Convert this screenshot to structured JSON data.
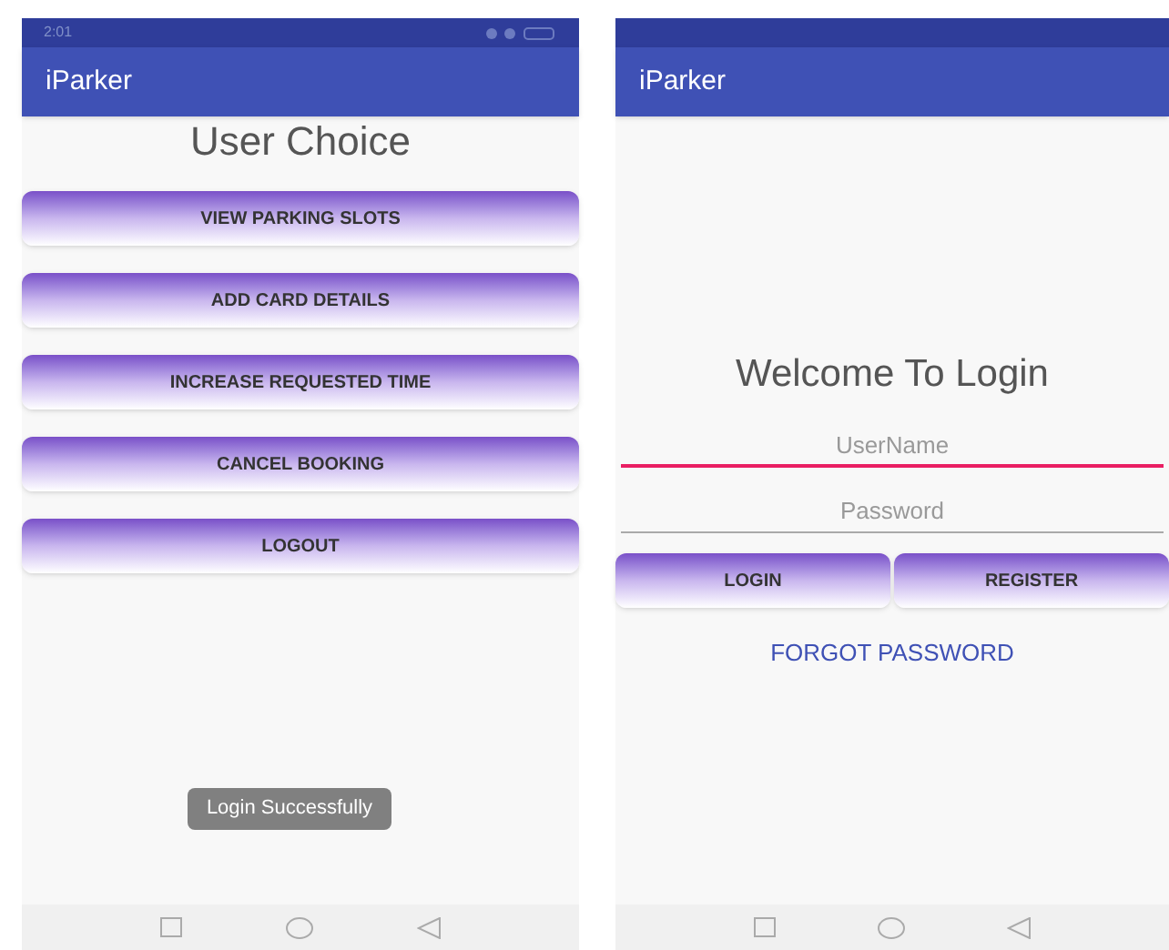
{
  "screens": [
    {
      "status_bar": {
        "time": "2:01"
      },
      "app_bar": {
        "title": "iParker"
      },
      "heading": "User Choice",
      "buttons": [
        "VIEW PARKING SLOTS",
        "ADD CARD DETAILS",
        "INCREASE REQUESTED TIME",
        "CANCEL BOOKING",
        "LOGOUT"
      ],
      "toast": "Login Successfully"
    },
    {
      "app_bar": {
        "title": "iParker"
      },
      "heading": "Welcome To Login",
      "fields": [
        {
          "placeholder": "UserName",
          "focused": true
        },
        {
          "placeholder": "Password",
          "focused": false
        }
      ],
      "buttons": [
        "LOGIN",
        "REGISTER"
      ],
      "link": "FORGOT PASSWORD"
    }
  ]
}
